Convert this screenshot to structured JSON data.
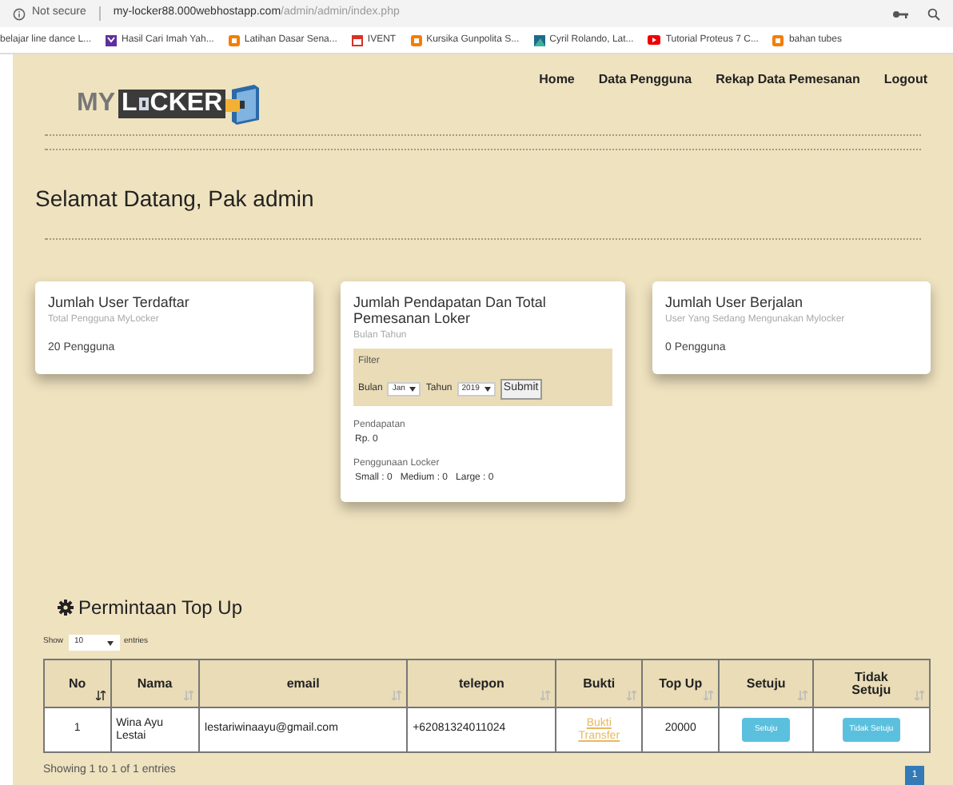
{
  "browser": {
    "security": "Not secure",
    "url_host": "my-locker88.000webhostapp.com",
    "url_path": "/admin/admin/index.php",
    "bookmarks": [
      {
        "label": "belajar line dance L...",
        "kind": "none"
      },
      {
        "label": "Hasil Cari Imah Yah...",
        "kind": "yahoo"
      },
      {
        "label": "Latihan Dasar Sena...",
        "kind": "blogger"
      },
      {
        "label": "IVENT",
        "kind": "calendar"
      },
      {
        "label": "Kursika Gunpolita S...",
        "kind": "blogger"
      },
      {
        "label": "Cyril Rolando, Lat...",
        "kind": "art"
      },
      {
        "label": "Tutorial Proteus 7 C...",
        "kind": "youtube"
      },
      {
        "label": "bahan tubes",
        "kind": "blogger"
      }
    ]
  },
  "header": {
    "logo_prefix": "MY",
    "logo_word": "L",
    "logo_word_rest": "CKER",
    "nav": [
      "Home",
      "Data Pengguna",
      "Rekap Data Pemesanan",
      "Logout"
    ]
  },
  "welcome": "Selamat Datang, Pak admin",
  "cards": [
    {
      "kind": "stat",
      "title": "Jumlah User Terdaftar",
      "subtitle": "Total Pengguna MyLocker",
      "value": "20 Pengguna"
    },
    {
      "kind": "filter",
      "title": "Jumlah Pendapatan Dan Total Pemesanan Loker",
      "subtitle": "Bulan Tahun",
      "filter_title": "Filter",
      "month_label": "Bulan",
      "month": "Jan",
      "year_label": "Tahun",
      "year": "2019",
      "submit": "Submit",
      "income_label": "Pendapatan",
      "income": "Rp. 0",
      "usage_label": "Penggunaan Locker",
      "usage": "Small : 0   Medium : 0   Large : 0"
    },
    {
      "kind": "stat",
      "title": "Jumlah User Berjalan",
      "subtitle": "User Yang Sedang Mengunakan Mylocker",
      "value": "0 Pengguna"
    }
  ],
  "topup": {
    "title": "Permintaan Top Up",
    "show_label": "Show",
    "page_size": "10",
    "entries_label": "entries",
    "columns": [
      {
        "label": "No",
        "sorted": true
      },
      {
        "label": "Nama",
        "sorted": false
      },
      {
        "label": "email",
        "sorted": false
      },
      {
        "label": "telepon",
        "sorted": false
      },
      {
        "label": "Bukti",
        "sorted": false
      },
      {
        "label": "Top Up",
        "sorted": false
      },
      {
        "label": "Setuju",
        "sorted": false
      },
      {
        "label": "Tidak Setuju",
        "sorted": false
      }
    ],
    "rows": [
      {
        "no": "1",
        "nama": "Wina Ayu Lestai",
        "email": "lestariwinaayu@gmail.com",
        "telepon": "+62081324011024",
        "bukti": "Bukti Transfer",
        "top_up": "20000",
        "approve": "Setuju",
        "reject": "Tidak Setuju"
      }
    ],
    "info": "Showing 1 to 1 of 1 entries",
    "page": "1"
  }
}
